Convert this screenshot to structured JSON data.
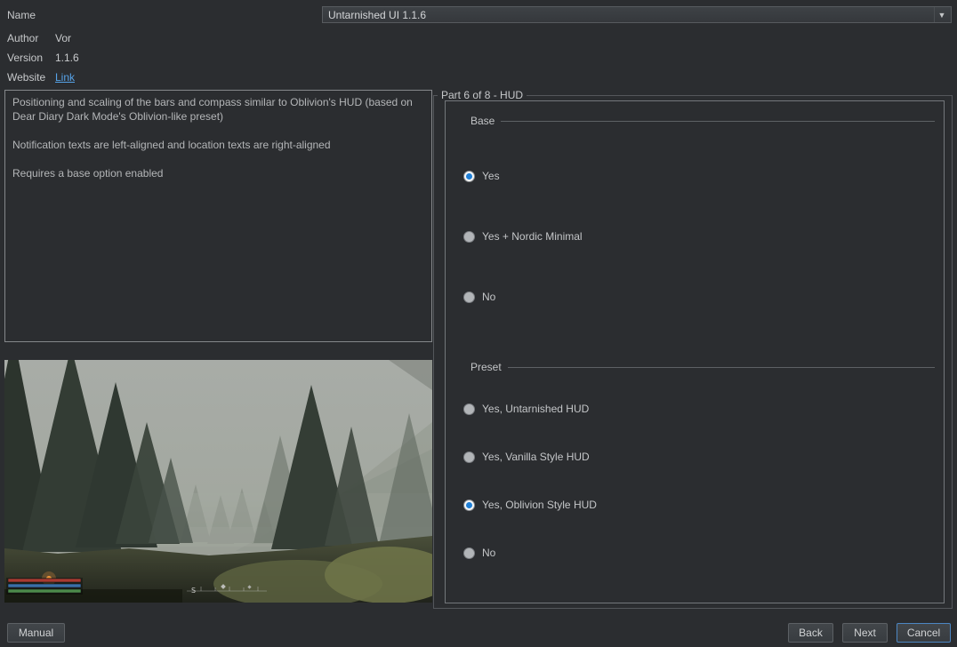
{
  "meta": {
    "name_label": "Name",
    "author_label": "Author",
    "author_value": "Vor",
    "version_label": "Version",
    "version_value": "1.1.6",
    "website_label": "Website",
    "website_value": "Link"
  },
  "mod_select": {
    "value": "Untarnished UI 1.1.6",
    "arrow_icon": "▼"
  },
  "description": {
    "paragraphs": [
      "Positioning and scaling of the bars and compass similar to Oblivion's HUD (based on Dear Diary Dark Mode's Oblivion-like preset)",
      "Notification texts are left-aligned and location texts are right-aligned",
      "Requires a base option enabled"
    ]
  },
  "step": {
    "title": "Part 6 of 8 - HUD",
    "groups": [
      {
        "label": "Base",
        "options": [
          {
            "label": "Yes",
            "selected": true
          },
          {
            "label": "Yes + Nordic Minimal",
            "selected": false
          },
          {
            "label": "No",
            "selected": false
          }
        ]
      },
      {
        "label": "Preset",
        "options": [
          {
            "label": "Yes, Untarnished HUD",
            "selected": false
          },
          {
            "label": "Yes, Vanilla Style HUD",
            "selected": false
          },
          {
            "label": "Yes, Oblivion Style HUD",
            "selected": true
          },
          {
            "label": "No",
            "selected": false
          }
        ]
      }
    ]
  },
  "footer": {
    "manual_label": "Manual",
    "back_label": "Back",
    "next_label": "Next",
    "cancel_label": "Cancel"
  },
  "colors": {
    "accent_blue": "#1f7fd6",
    "link_blue": "#56a3e8",
    "hud_health": "#a93a30",
    "hud_magicka": "#3a6fa8",
    "hud_stamina": "#4c8a4a"
  }
}
